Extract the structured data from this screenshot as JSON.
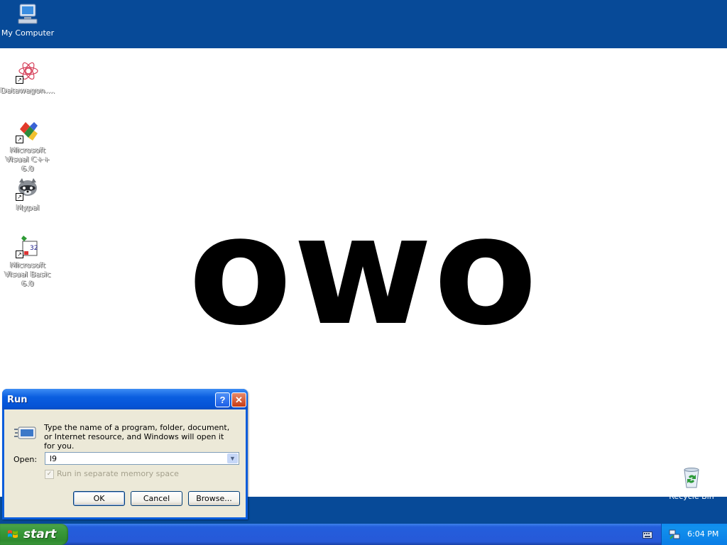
{
  "desktop": {
    "big_text": "owo",
    "icons": [
      {
        "label": "My Computer"
      },
      {
        "label": "Datawagon...."
      },
      {
        "label": "Microsoft Visual C++ 6.0"
      },
      {
        "label": "Mypal"
      },
      {
        "label": "Microsoft Visual Basic 6.0"
      },
      {
        "label": "Recycle Bin"
      }
    ]
  },
  "run_dialog": {
    "title": "Run",
    "help_glyph": "?",
    "close_glyph": "✕",
    "description": "Type the name of a program, folder, document, or Internet resource, and Windows will open it for you.",
    "open_label": "Open:",
    "open_value": "l9",
    "checkbox_label": "Run in separate memory space",
    "ok_label": "OK",
    "cancel_label": "Cancel",
    "browse_label": "Browse..."
  },
  "taskbar": {
    "start_label": "start",
    "clock": "6:04 PM"
  },
  "colors": {
    "desktop_blue": "#074a98",
    "wallpaper": "#ffffff",
    "start_green": "#389838",
    "taskbar_blue": "#245edc",
    "tray_blue": "#1191ed"
  }
}
